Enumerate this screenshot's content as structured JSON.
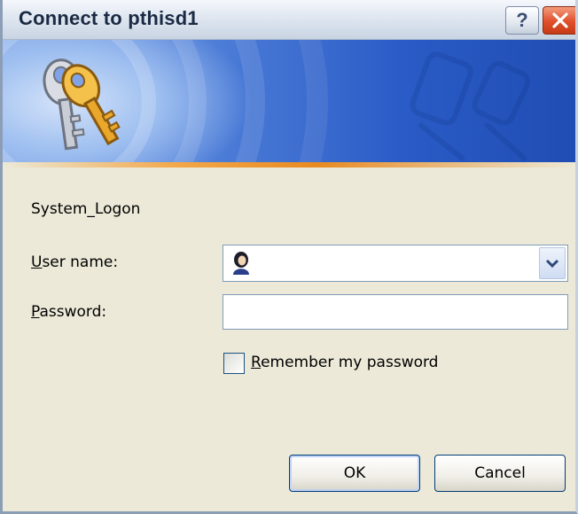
{
  "window": {
    "title": "Connect to pthisd1",
    "help_label": "?",
    "close_label": "✕"
  },
  "body": {
    "system_label": "System_Logon",
    "username_label_accel": "U",
    "username_label_rest": "ser name:",
    "username_value": "",
    "password_label_accel": "P",
    "password_label_rest": "assword:",
    "password_value": "",
    "remember_accel": "R",
    "remember_rest": "emember my password",
    "remember_checked": false
  },
  "buttons": {
    "ok_label": "OK",
    "cancel_label": "Cancel"
  },
  "icons": {
    "banner": "keys-icon",
    "user": "user-icon",
    "dropdown": "chevron-down-icon"
  }
}
